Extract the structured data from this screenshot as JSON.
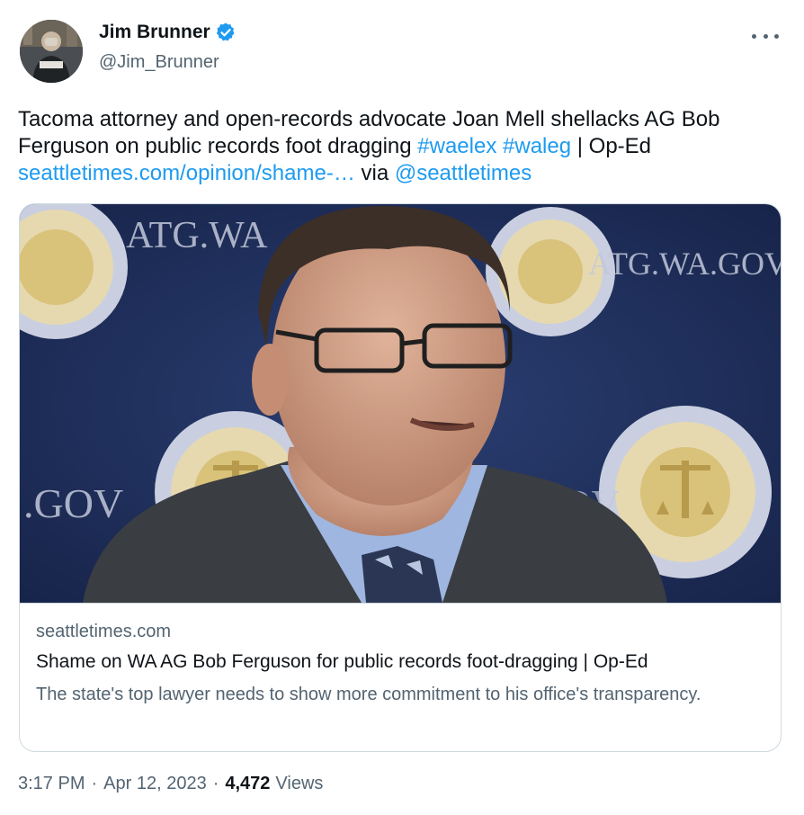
{
  "author": {
    "display_name": "Jim Brunner",
    "handle": "@Jim_Brunner",
    "verified": true,
    "verified_color": "#1d9bf0"
  },
  "tweet": {
    "text_1": "Tacoma attorney and open-records advocate Joan Mell shellacks AG Bob Ferguson on public records foot dragging ",
    "hashtag_1": "#waelex",
    "hashtag_2": "#waleg",
    "text_2": " | Op-Ed ",
    "link": "seattletimes.com/opinion/shame-…",
    "text_3": " via ",
    "mention": "@seattletimes",
    "link_color": "#1d9bf0"
  },
  "card": {
    "domain": "seattletimes.com",
    "title": "Shame on WA AG Bob Ferguson for public records foot-dragging | Op-Ed",
    "description": "The state's top lawyer needs to show more commitment to his office's transparency.",
    "image_backdrop_text_1": "ATG.WA",
    "image_backdrop_text_2": "ATG.WA.GOV",
    "image_backdrop_text_3": ".GOV",
    "image_backdrop_text_4": "GOV"
  },
  "footer": {
    "time": "3:17 PM",
    "separator": "·",
    "date": "Apr 12, 2023",
    "views_count": "4,472",
    "views_label": "Views"
  },
  "icons": {
    "verified": "verified-badge-icon",
    "more": "more-horizontal-icon"
  }
}
